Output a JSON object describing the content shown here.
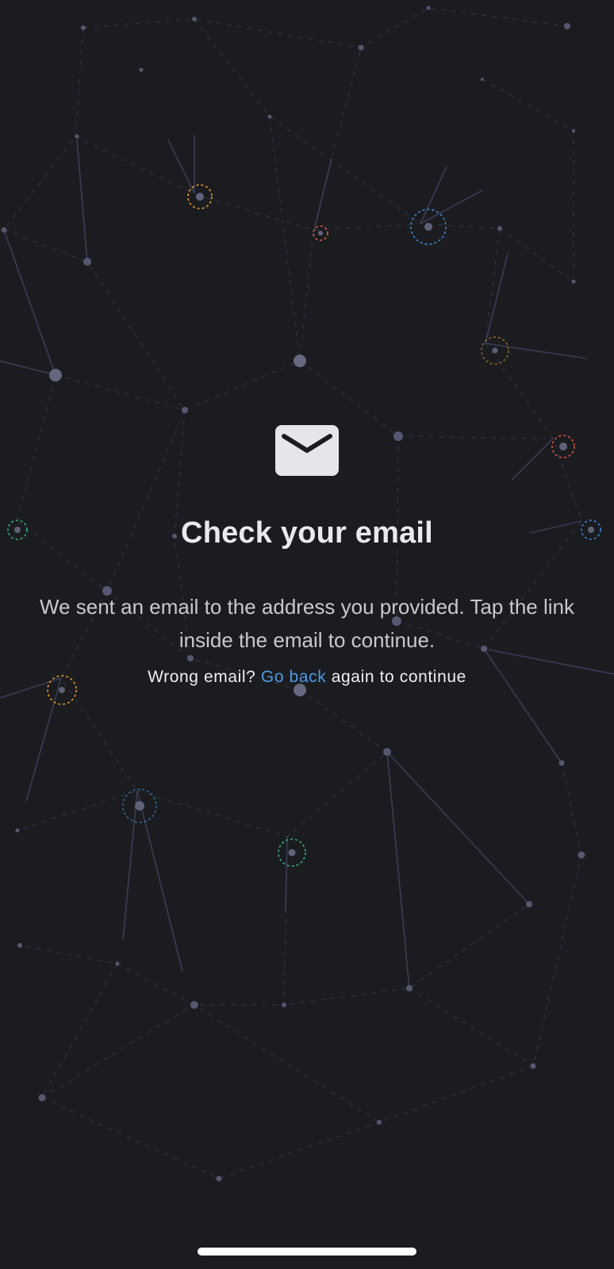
{
  "screen": {
    "background_color": "#1b1c1f",
    "accent_link_color": "#4e9ae6",
    "decor_colors": [
      "#e39a2b",
      "#e0553a",
      "#3f86d6",
      "#33b07a"
    ]
  },
  "icon": {
    "name": "envelope-icon"
  },
  "title": "Check your email",
  "description": "We sent an email to the address you provided. Tap the link inside the email to continue.",
  "hint": {
    "prefix": "Wrong email?",
    "link_label": "Go back",
    "suffix": "again to continue"
  }
}
